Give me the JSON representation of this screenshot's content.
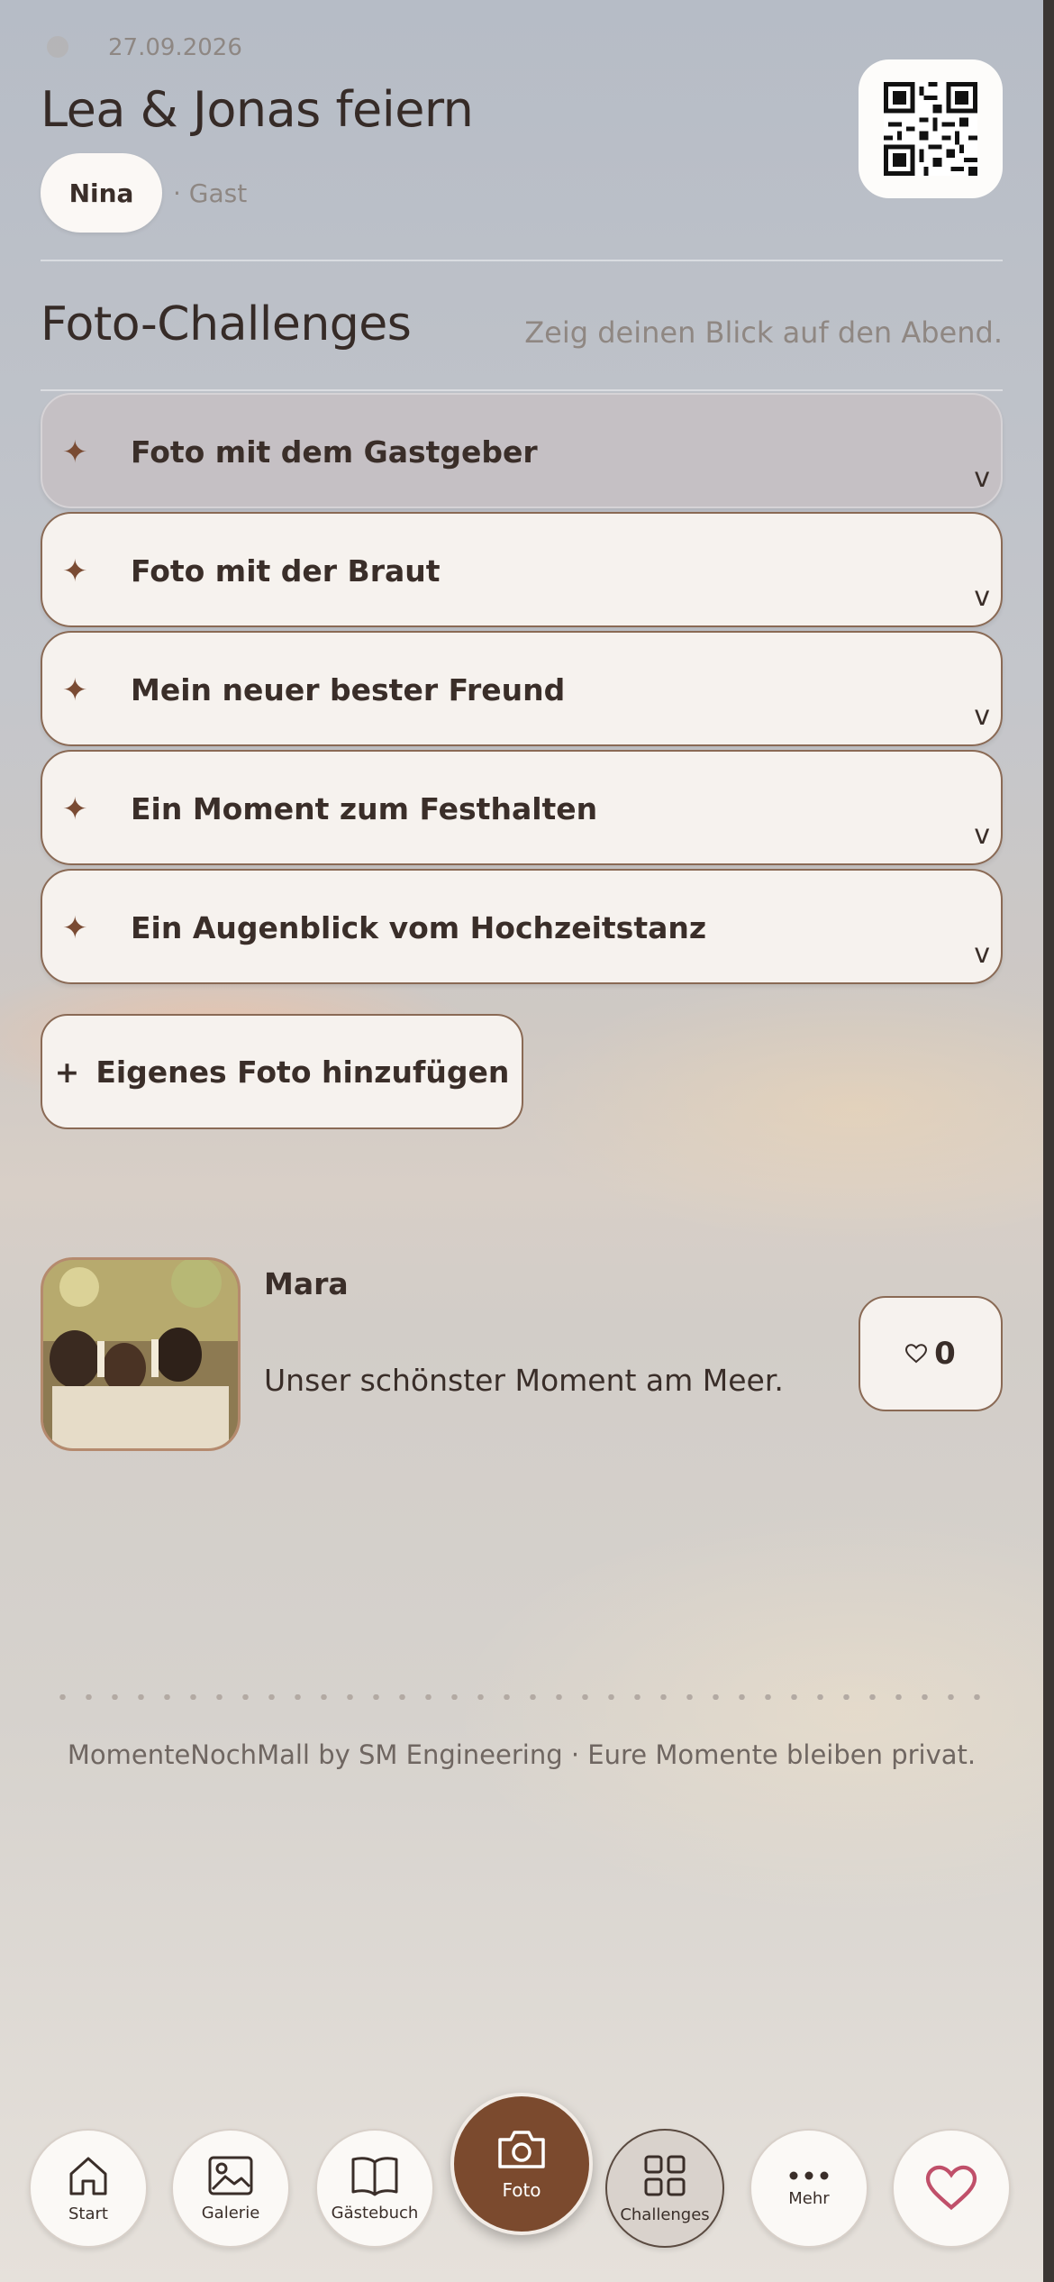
{
  "event": {
    "date": "27.09.2026",
    "title": "Lea & Jonas feiern",
    "user_name": "Nina",
    "user_role": "· Gast"
  },
  "section": {
    "title": "Foto-Challenges",
    "subtitle": "Zeig deinen Blick auf den Abend."
  },
  "challenges": [
    {
      "label": "Foto mit dem Gastgeber",
      "expanded": false,
      "active": true
    },
    {
      "label": "Foto mit der Braut",
      "expanded": false,
      "active": false
    },
    {
      "label": "Mein neuer bester Freund",
      "expanded": false,
      "active": false
    },
    {
      "label": "Ein Moment zum Festhalten",
      "expanded": false,
      "active": false
    },
    {
      "label": "Ein Augenblick vom Hochzeitstanz",
      "expanded": false,
      "active": false
    }
  ],
  "chevron_glyph": "v",
  "star_glyph": "✦",
  "add_button": {
    "icon": "+",
    "label": "Eigenes Foto hinzufügen"
  },
  "post": {
    "author": "Mara",
    "caption": "Unser schönster Moment am Meer.",
    "likes": "0",
    "like_icon": "heart-outline-icon"
  },
  "footer": "MomenteNochMall by SM Engineering · Eure Momente bleiben privat.",
  "nav": [
    {
      "label": "Start",
      "icon": "home-icon"
    },
    {
      "label": "Galerie",
      "icon": "image-icon"
    },
    {
      "label": "Gästebuch",
      "icon": "book-icon"
    },
    {
      "label": "Foto",
      "icon": "camera-icon"
    },
    {
      "label": "Challenges",
      "icon": "grid-icon",
      "selected": true
    },
    {
      "label": "Mehr",
      "icon": "more-icon"
    },
    {
      "label": "",
      "icon": "heart-icon"
    }
  ],
  "colors": {
    "accent": "#7b4a2e",
    "card_bg": "#f6f2ee",
    "border": "#8a6a55",
    "text": "#3a2e29",
    "heart": "#c0506a"
  }
}
